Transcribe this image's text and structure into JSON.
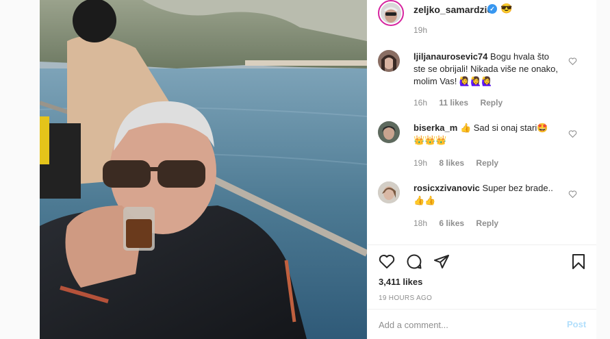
{
  "post": {
    "author": "zeljko_samardzic",
    "author_emoji": "😎",
    "time": "19h",
    "likes_total": "3,411 likes",
    "age": "19 HOURS AGO"
  },
  "comments": [
    {
      "user": "ljiljanaurosevic74",
      "text": "Bogu hvala što ste se obrijali! Nikada više ne onako, molim Vas! 🙋‍♀️🙋‍♀️🙋‍♀️",
      "time": "16h",
      "likes": "11 likes",
      "reply": "Reply"
    },
    {
      "user": "biserka_m",
      "text": "👍 Sad si onaj stari🤩 👑👑👑",
      "time": "19h",
      "likes": "8 likes",
      "reply": "Reply"
    },
    {
      "user": "rosicxzivanovic",
      "text": "Super bez brade.. 👍👍",
      "time": "18h",
      "likes": "6 likes",
      "reply": "Reply"
    }
  ],
  "add_comment": {
    "placeholder": "Add a comment...",
    "post_label": "Post"
  },
  "icons": {
    "verified": "verified-badge-icon",
    "heart": "heart-icon",
    "comment": "comment-icon",
    "share": "share-icon",
    "save": "bookmark-icon"
  },
  "colors": {
    "accent": "#3897f0",
    "post_disabled": "#b2dffc",
    "story_ring": "#d6249f"
  }
}
